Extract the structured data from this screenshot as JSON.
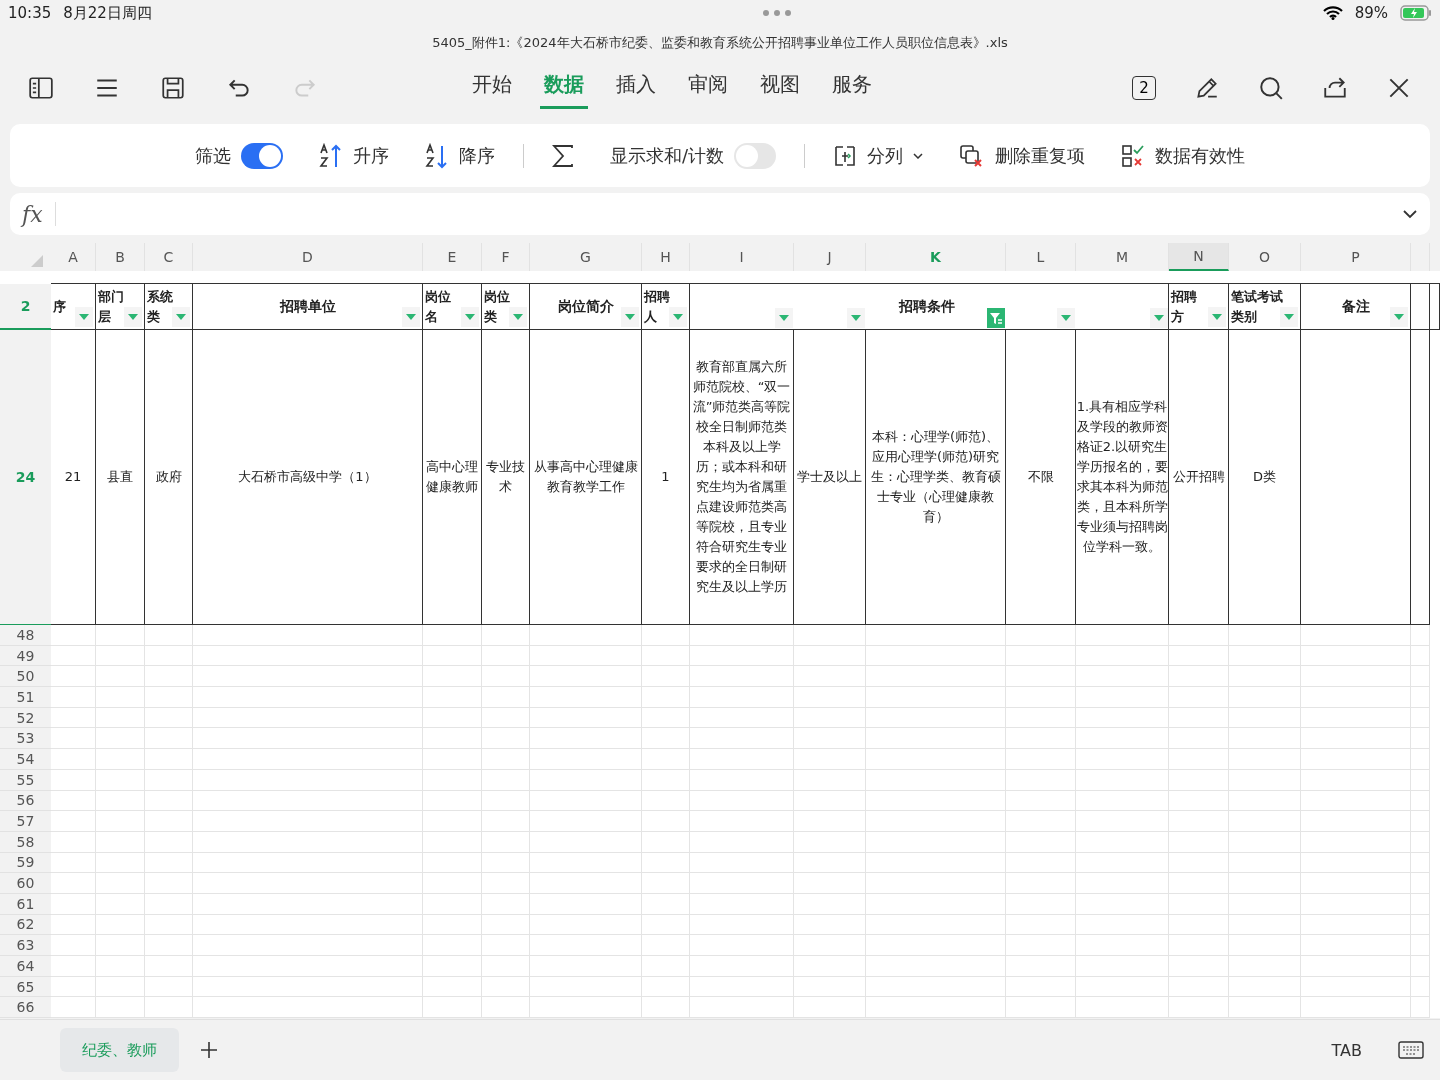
{
  "status_bar": {
    "time": "10:35",
    "date": "8月22日周四",
    "battery": "89%"
  },
  "window": {
    "title": "5405_附件1:《2024年大石桥市纪委、监委和教育系统公开招聘事业单位工作人员职位信息表》.xls"
  },
  "toolbar": {
    "redo_disabled": true,
    "window_count": "2"
  },
  "tabs": [
    {
      "label": "开始",
      "selected": false
    },
    {
      "label": "数据",
      "selected": true
    },
    {
      "label": "插入",
      "selected": false
    },
    {
      "label": "审阅",
      "selected": false
    },
    {
      "label": "视图",
      "selected": false
    },
    {
      "label": "服务",
      "selected": false
    }
  ],
  "ribbon": [
    {
      "kind": "toggle",
      "label": "筛选",
      "on": true
    },
    {
      "kind": "sort_asc",
      "label": "升序"
    },
    {
      "kind": "sort_desc",
      "label": "降序"
    },
    {
      "kind": "separator"
    },
    {
      "kind": "sum"
    },
    {
      "kind": "toggle",
      "label": "显示求和/计数",
      "on": false
    },
    {
      "kind": "separator"
    },
    {
      "kind": "split",
      "label": "分列"
    },
    {
      "kind": "dedupe",
      "label": "删除重复项"
    },
    {
      "kind": "validate",
      "label": "数据有效性"
    }
  ],
  "formula_bar": {
    "label": "fx"
  },
  "column_headers": [
    {
      "label": "A",
      "selected": false,
      "filtered": false
    },
    {
      "label": "B",
      "selected": false,
      "filtered": false
    },
    {
      "label": "C",
      "selected": false,
      "filtered": false
    },
    {
      "label": "D",
      "selected": false,
      "filtered": false
    },
    {
      "label": "E",
      "selected": false,
      "filtered": false
    },
    {
      "label": "F",
      "selected": false,
      "filtered": false
    },
    {
      "label": "G",
      "selected": false,
      "filtered": false
    },
    {
      "label": "H",
      "selected": false,
      "filtered": false
    },
    {
      "label": "I",
      "selected": false,
      "filtered": false
    },
    {
      "label": "J",
      "selected": false,
      "filtered": false
    },
    {
      "label": "K",
      "selected": false,
      "filtered": true
    },
    {
      "label": "L",
      "selected": false,
      "filtered": false
    },
    {
      "label": "M",
      "selected": false,
      "filtered": false
    },
    {
      "label": "N",
      "selected": true,
      "filtered": false
    },
    {
      "label": "O",
      "selected": false,
      "filtered": false
    },
    {
      "label": "P",
      "selected": false,
      "filtered": false
    }
  ],
  "header_row": {
    "row_number": "2",
    "highlighted": true,
    "cells": [
      {
        "kind": "column",
        "text": "序",
        "filtered": false
      },
      {
        "kind": "column",
        "text": "部门层",
        "filtered": false
      },
      {
        "kind": "column",
        "text": "系统类",
        "filtered": false
      },
      {
        "kind": "column",
        "text": "招聘单位",
        "filtered": false
      },
      {
        "kind": "column",
        "text": "岗位名",
        "filtered": false
      },
      {
        "kind": "column",
        "text": "岗位类",
        "filtered": false
      },
      {
        "kind": "column",
        "text": "岗位简介",
        "filtered": false
      },
      {
        "kind": "column",
        "text": "招聘人",
        "filtered": false
      },
      {
        "kind": "group",
        "title": "招聘条件",
        "filters": [
          {
            "filtered": false
          },
          {
            "filtered": false
          },
          {
            "filtered": true
          },
          {
            "filtered": false
          },
          {
            "filtered": false
          }
        ]
      },
      {
        "kind": "column",
        "text": "招聘方",
        "filtered": false
      },
      {
        "kind": "column",
        "text": "笔试考试类别",
        "filtered": false
      },
      {
        "kind": "column",
        "text": "备注",
        "filtered": false
      }
    ]
  },
  "data_row": {
    "row_number": "24",
    "highlighted": true,
    "cells": [
      "21",
      "县直",
      "政府",
      "大石桥市高级中学（1）",
      "高中心理健康教师",
      "专业技术",
      "从事高中心理健康教育教学工作",
      "1",
      "教育部直属六所师范院校、“双一流”师范类高等院校全日制师范类本科及以上学历；或本科和研究生均为省属重点建设师范类高等院校，且专业符合研究生专业要求的全日制研究生及以上学历",
      "学士及以上",
      "本科：心理学(师范)、应用心理学(师范)研究生：心理学类、教育硕士专业（心理健康教育）",
      "不限",
      "1.具有相应学科及学段的教师资格证2.以研究生学历报名的，要求其本科为师范类，且本科所学专业须与招聘岗位学科一致。",
      "公开招聘",
      "D类"
    ]
  },
  "empty_rows": [
    "48",
    "49",
    "50",
    "51",
    "52",
    "53",
    "54",
    "55",
    "56",
    "57",
    "58",
    "59",
    "60",
    "61",
    "62",
    "63",
    "64",
    "65",
    "66"
  ],
  "sheet_tabs": [
    {
      "label": "纪委、教师",
      "selected": true
    }
  ],
  "bottom_bar": {
    "tab_key": "TAB"
  }
}
